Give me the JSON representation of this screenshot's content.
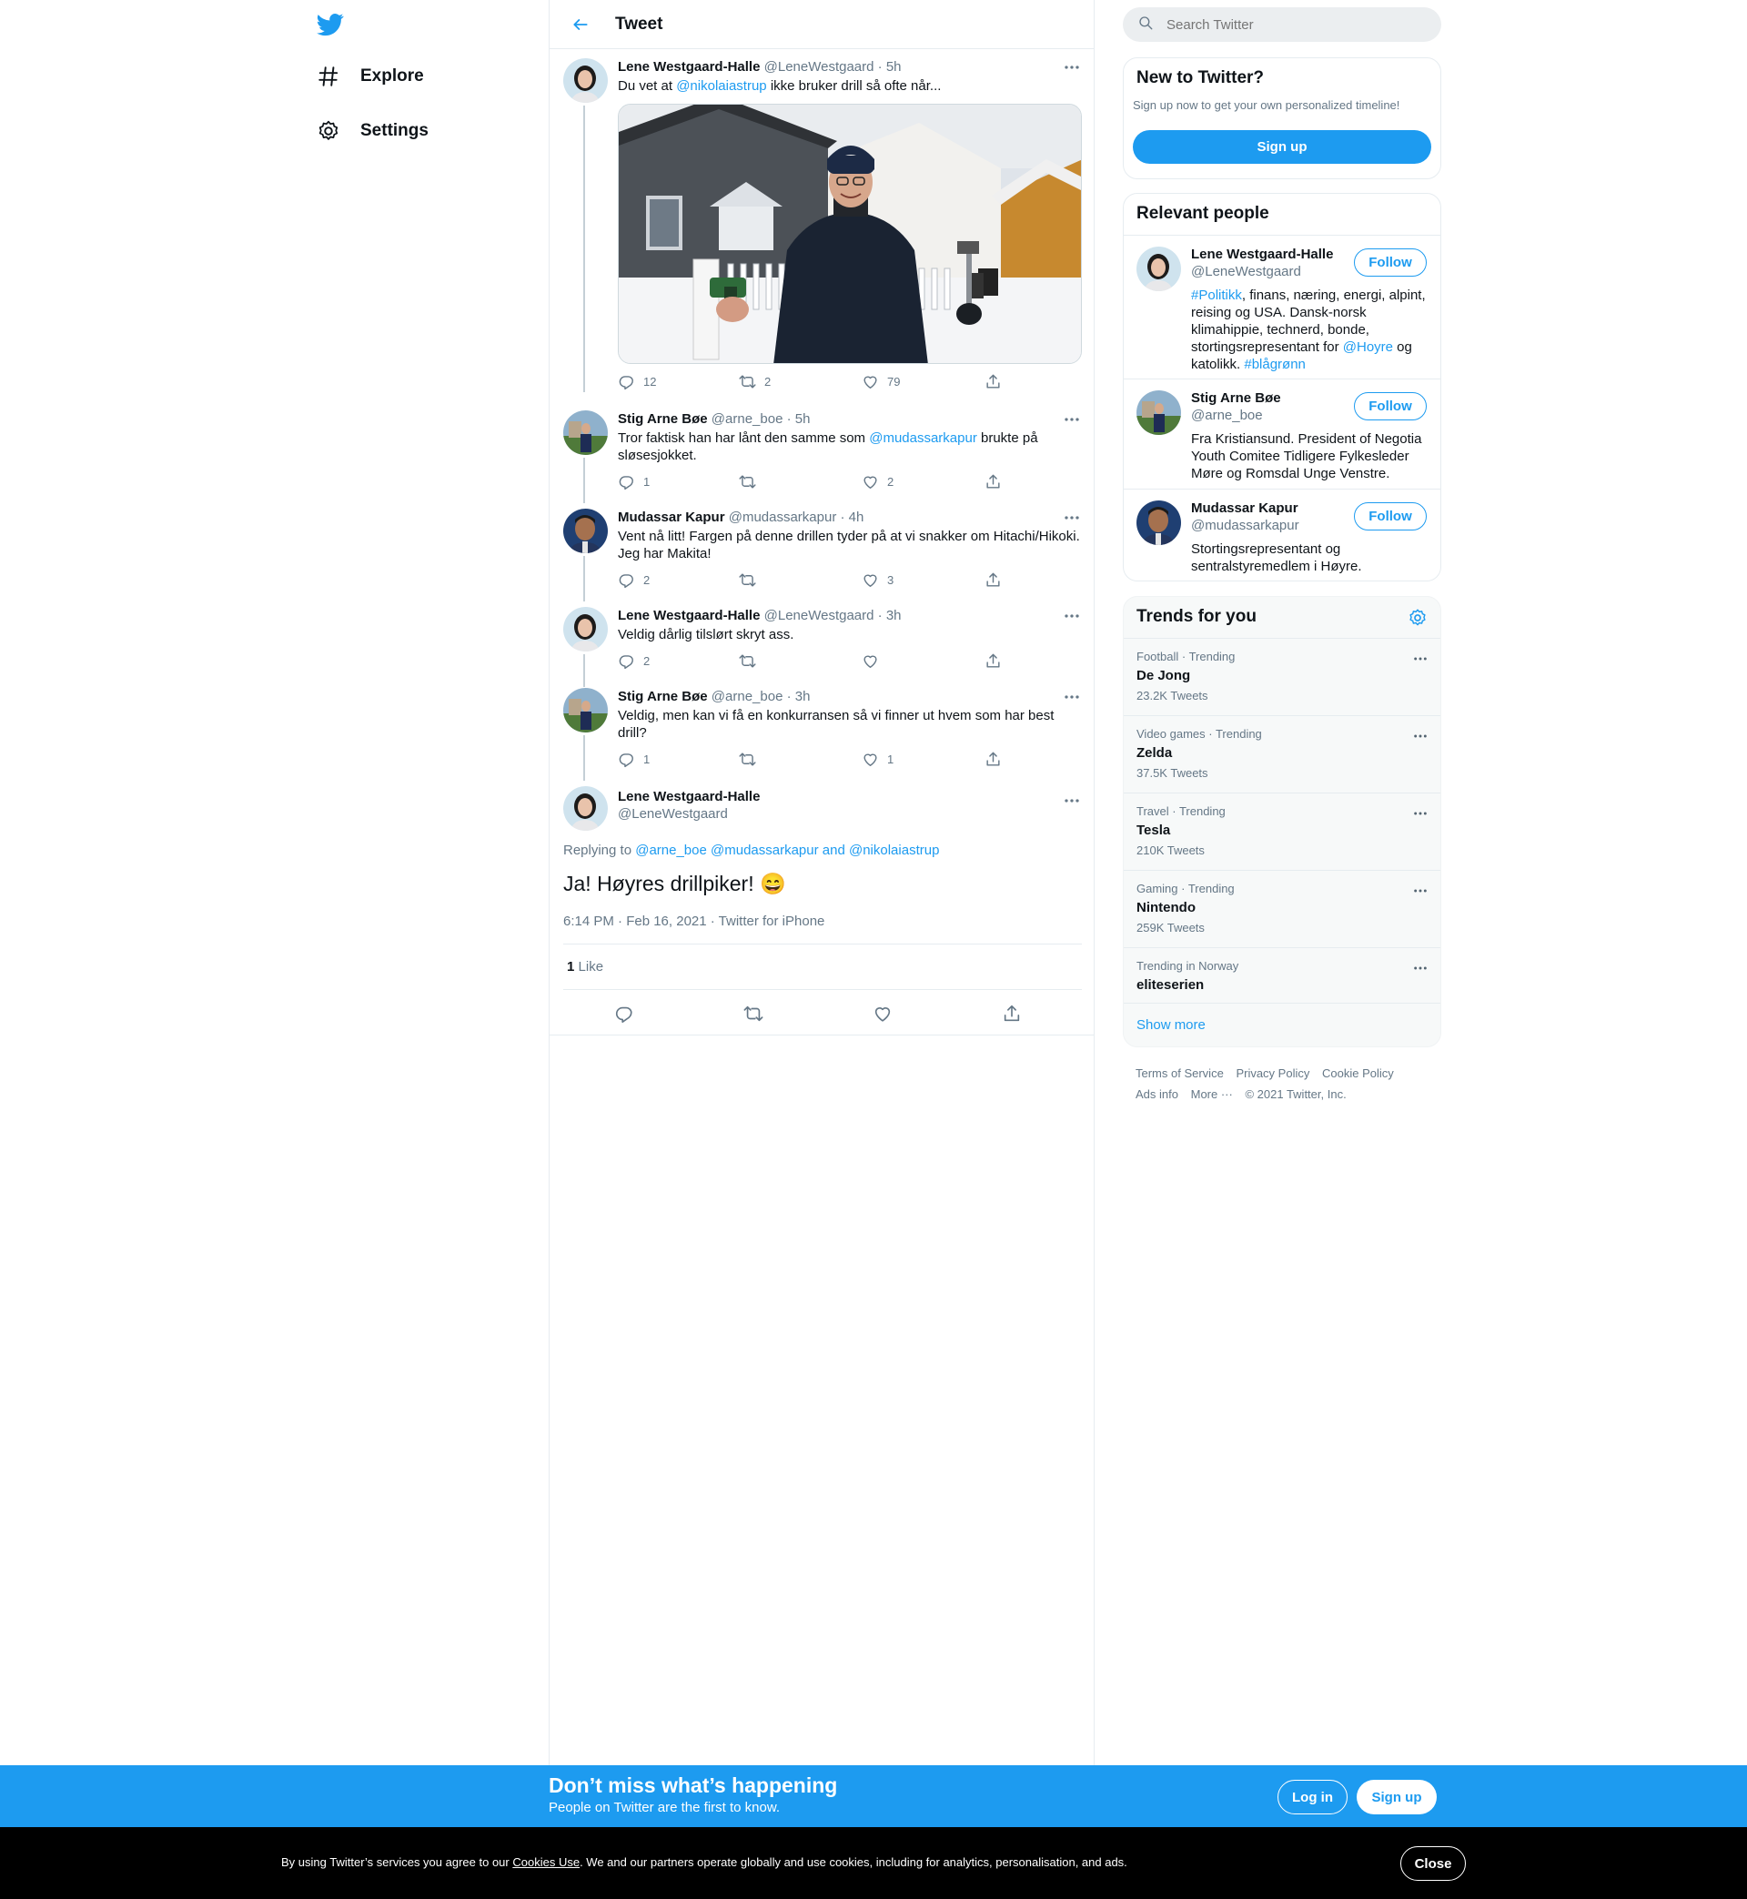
{
  "nav": {
    "explore_label": "Explore",
    "settings_label": "Settings"
  },
  "header": {
    "title": "Tweet"
  },
  "thread": [
    {
      "name": "Lene Westgaard-Halle",
      "handle": "@LeneWestgaard",
      "time": "· 5h",
      "text_pre": "Du vet at ",
      "mention": "@nikolaiastrup",
      "text_post": " ikke bruker drill så ofte når...",
      "replies": "12",
      "retweets": "2",
      "likes": "79"
    },
    {
      "name": "Stig Arne Bøe",
      "handle": "@arne_boe",
      "time": "· 5h",
      "text_pre": "Tror faktisk han har lånt den samme som ",
      "mention": "@mudassarkapur",
      "text_post": " brukte på sløsesjokket.",
      "replies": "1",
      "retweets": "",
      "likes": "2"
    },
    {
      "name": "Mudassar Kapur",
      "handle": "@mudassarkapur",
      "time": "· 4h",
      "text": "Vent nå litt! Fargen på denne drillen tyder på at vi snakker om Hitachi/Hikoki. Jeg har Makita!",
      "replies": "2",
      "retweets": "",
      "likes": "3"
    },
    {
      "name": "Lene Westgaard-Halle",
      "handle": "@LeneWestgaard",
      "time": "· 3h",
      "text": "Veldig dårlig tilslørt skryt ass.",
      "replies": "2",
      "retweets": "",
      "likes": ""
    },
    {
      "name": "Stig Arne Bøe",
      "handle": "@arne_boe",
      "time": "· 3h",
      "text": "Veldig, men kan vi få en konkurransen så vi finner ut hvem som har best drill?",
      "replies": "1",
      "retweets": "",
      "likes": "1"
    }
  ],
  "focus": {
    "name": "Lene Westgaard-Halle",
    "handle": "@LeneWestgaard",
    "replying_label": "Replying to ",
    "replying_to": "@arne_boe @mudassarkapur and @nikolaiastrup",
    "text": "Ja! Høyres drillpiker! 😄",
    "meta": "6:14 PM · Feb 16, 2021 · Twitter for iPhone",
    "like_count": "1",
    "like_label": "Like"
  },
  "search": {
    "placeholder": "Search Twitter"
  },
  "new_to_twitter": {
    "title": "New to Twitter?",
    "subtitle": "Sign up now to get your own personalized timeline!",
    "button": "Sign up"
  },
  "relevant": {
    "title": "Relevant people",
    "follow_label": "Follow",
    "people": [
      {
        "name": "Lene Westgaard-Halle",
        "handle": "@LeneWestgaard",
        "bio_tag": "#Politikk",
        "bio": ", finans, næring, energi, alpint, reising og USA. Dansk-norsk klimahippie, technerd, bonde, stortingsrepresentant for ",
        "bio_mention": "@Hoyre",
        "bio_end": " og katolikk. ",
        "bio_tag2": "#blågrønn"
      },
      {
        "name": "Stig Arne Bøe",
        "handle": "@arne_boe",
        "bio": "Fra Kristiansund. President of Negotia Youth Comitee Tidligere Fylkesleder Møre og Romsdal Unge Venstre."
      },
      {
        "name": "Mudassar Kapur",
        "handle": "@mudassarkapur",
        "bio": "Stortingsrepresentant og sentralstyremedlem i Høyre."
      }
    ]
  },
  "trends": {
    "title": "Trends for you",
    "items": [
      {
        "context": "Football · Trending",
        "name": "De Jong",
        "count": "23.2K Tweets"
      },
      {
        "context": "Video games · Trending",
        "name": "Zelda",
        "count": "37.5K Tweets"
      },
      {
        "context": "Travel · Trending",
        "name": "Tesla",
        "count": "210K Tweets"
      },
      {
        "context": "Gaming · Trending",
        "name": "Nintendo",
        "count": "259K Tweets"
      },
      {
        "context": "Trending in Norway",
        "name": "eliteserien",
        "count": ""
      }
    ],
    "show_more": "Show more"
  },
  "footer": {
    "terms": "Terms of Service",
    "privacy": "Privacy Policy",
    "cookie": "Cookie Policy",
    "ads": "Ads info",
    "more": "More ···",
    "copyright": "© 2021 Twitter, Inc."
  },
  "signup_bar": {
    "headline": "Don’t miss what’s happening",
    "sub": "People on Twitter are the first to know.",
    "login": "Log in",
    "signup": "Sign up"
  },
  "cookie_bar": {
    "text_pre": "By using Twitter’s services you agree to our ",
    "link": "Cookies Use",
    "text_post": ". We and our partners operate globally and use cookies, including for analytics, personalisation, and ads.",
    "close": "Close"
  },
  "colors": {
    "accent": "#1d9bf0",
    "text": "#0f1419",
    "muted": "#657786"
  },
  "icons": [
    "twitter-logo-icon",
    "hashtag-icon",
    "gear-icon",
    "back-arrow-icon",
    "search-icon",
    "more-dots-icon",
    "reply-icon",
    "retweet-icon",
    "like-icon",
    "share-icon"
  ]
}
